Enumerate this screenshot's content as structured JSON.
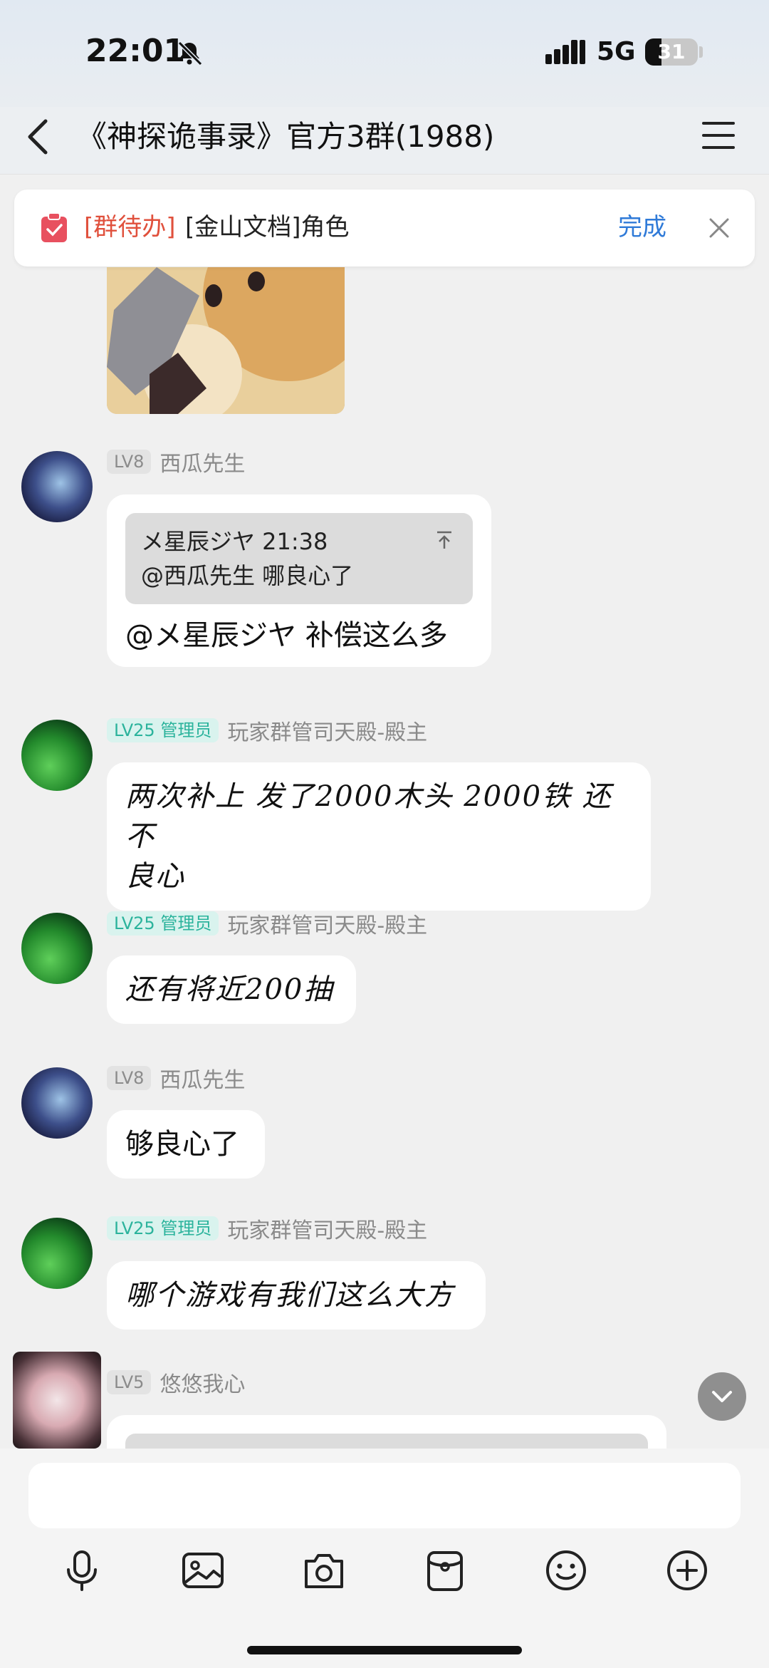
{
  "status_bar": {
    "time": "22:01",
    "network": "5G",
    "battery_level": "31",
    "battery_fraction": 0.31
  },
  "header": {
    "title": "《神探诡事录》官方3群(1988)"
  },
  "todo_banner": {
    "tag": "[群待办]",
    "text": "[金山文档]角色",
    "done_label": "完成"
  },
  "messages": [
    {
      "level": "LV8",
      "sender": "西瓜先生",
      "quote_header": "メ星辰ジヤ 21:38",
      "quote_text": "@西瓜先生 哪良心了",
      "text": "@メ星辰ジヤ 补偿这么多"
    },
    {
      "level": "LV25 管理员",
      "sender": "玩家群管司天殿-殿主",
      "text_line1": "两次补上 发了2000木头 2000铁 还不",
      "text_line2": "良心"
    },
    {
      "level": "LV25 管理员",
      "sender": "玩家群管司天殿-殿主",
      "text": "还有将近200抽"
    },
    {
      "level": "LV8",
      "sender": "西瓜先生",
      "text": "够良心了"
    },
    {
      "level": "LV25 管理员",
      "sender": "玩家群管司天殿-殿主",
      "text": "哪个游戏有我们这么大方"
    },
    {
      "level": "LV5",
      "sender": "悠悠我心"
    }
  ],
  "input": {
    "placeholder": "",
    "value": ""
  },
  "toolbar": {
    "icons": [
      "microphone-icon",
      "image-icon",
      "camera-icon",
      "red-packet-icon",
      "emoji-icon",
      "plus-icon"
    ]
  },
  "colors": {
    "todo_tag": "#e0503c",
    "done": "#2f7ad8",
    "admin_badge": "#2bb39c"
  }
}
